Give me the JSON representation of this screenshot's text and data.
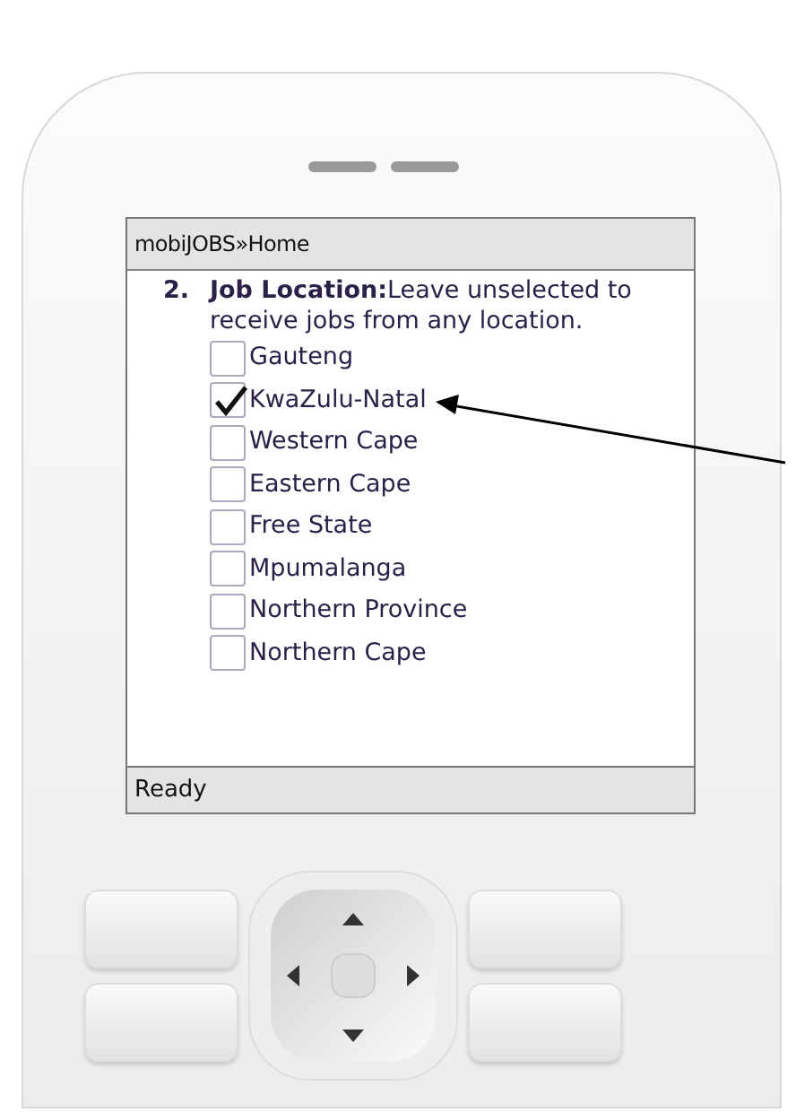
{
  "screen": {
    "title": "mobiJOBS»Home",
    "question": {
      "number": "2.",
      "text": "**Job Location:**Leave unselected to receive jobs from any location."
    },
    "options": [
      {
        "label": "Gauteng",
        "checked": false
      },
      {
        "label": "KwaZulu-Natal",
        "checked": true
      },
      {
        "label": "Western Cape",
        "checked": false
      },
      {
        "label": "Eastern Cape",
        "checked": false
      },
      {
        "label": "Free State",
        "checked": false
      },
      {
        "label": "Mpumalanga",
        "checked": false
      },
      {
        "label": "Northern Province",
        "checked": false
      },
      {
        "label": "Northern Cape",
        "checked": false
      }
    ],
    "status_bar": "Ready"
  }
}
